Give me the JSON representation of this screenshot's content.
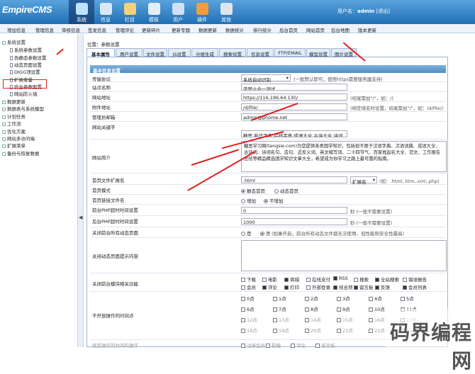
{
  "logo": {
    "text": "EmpireCMS"
  },
  "main_nav": [
    {
      "label": "系统",
      "icon": "monitor-icon",
      "color": "#bfe3ff"
    },
    {
      "label": "信息",
      "icon": "chat-icon",
      "color": "#d7e9f8"
    },
    {
      "label": "栏目",
      "icon": "folder-icon",
      "color": "#f3d27b"
    },
    {
      "label": "模板",
      "icon": "template-icon",
      "color": "#e2eef8"
    },
    {
      "label": "用户",
      "icon": "users-icon",
      "color": "#cfe2f5"
    },
    {
      "label": "插件",
      "icon": "plugin-icon",
      "color": "#f29d3a"
    },
    {
      "label": "其他",
      "icon": "gear-icon",
      "color": "#dde6ee"
    }
  ],
  "user": {
    "prefix": "用户名：",
    "name": "admin",
    "logout": "[退出]"
  },
  "sub_nav": [
    "增加信息",
    "管理信息",
    "审核信息",
    "签发信息",
    "管理评论",
    "更新碎片",
    "更新专题",
    "数据更新",
    "数据统计",
    "排行统计",
    "后台首页",
    "网站首页",
    "后台地图",
    "版本更新"
  ],
  "sidebar": [
    {
      "label": "系统设置",
      "type": "folder"
    },
    {
      "label": "系统参数设置",
      "type": "doc"
    },
    {
      "label": "伪静态参数设置",
      "type": "doc"
    },
    {
      "label": "动态页面设置",
      "type": "doc"
    },
    {
      "label": "DIGG顶设置",
      "type": "doc"
    },
    {
      "label": "扩展变量",
      "type": "doc"
    },
    {
      "label": "安全参数配置",
      "type": "doc"
    },
    {
      "label": "网站防火墙",
      "type": "doc"
    },
    {
      "label": "数据更新",
      "type": "folder"
    },
    {
      "label": "数据表与系统模型",
      "type": "folder"
    },
    {
      "label": "计划任务",
      "type": "folder"
    },
    {
      "label": "工作流",
      "type": "folder"
    },
    {
      "label": "优化方案",
      "type": "folder"
    },
    {
      "label": "网站多访问端",
      "type": "folder"
    },
    {
      "label": "扩展菜单",
      "type": "folder"
    },
    {
      "label": "备份与恢复数据",
      "type": "folder"
    }
  ],
  "splitter": {
    "label": "◀"
  },
  "breadcrumb": "位置：参数设置",
  "tabs": [
    "基本属性",
    "用户设置",
    "文件设置",
    "JS设置",
    "分组生成",
    "搜索设置",
    "信息设置",
    "FTP/EMAIL",
    "模型设置",
    "图片设置"
  ],
  "section_title": "基本信息设置",
  "form": {
    "protocol": {
      "label": "传输协议",
      "value": "系统自动识别",
      "hint": "(一般默认即可，使用https需要服务器支持)"
    },
    "site_name": {
      "label": "站点名称",
      "value": "帝国十合一测试"
    },
    "site_url": {
      "label": "网站地址",
      "value": "https://116.196.64.130/",
      "hint": "(结尾需加\"/\"，如：/)"
    },
    "attach_url": {
      "label": "附件地址",
      "value": "/d/file/",
      "hint": "(绑定域名时设置，结尾需加\"/\"，如：/d/file/)"
    },
    "admin_email": {
      "label": "管理员邮箱",
      "value": "admin@phome.net"
    },
    "keywords": {
      "label": "网站关键字",
      "value": "糖思,新华字典,在线字典,成语大全,古诗大全,诗词"
    },
    "description": {
      "label": "网站简介",
      "value": "糖思学习网(tangsie.com)为您提供各类国学知识，包括但不限于汉语字典、汉语词典、成语大全、古诗词、诗词名句、造句、近反义词、英文缩写词、二十四节气、百家姓起名大全、范文、工作报告总结等精品精选国学知识文章大全，希望成为你学习之路上最可靠的指南。"
    },
    "index_ext": {
      "label": "首页文件扩展名",
      "value": ".html",
      "select": "扩展名",
      "hint": "(如：.html,.htm,.xml,.php)"
    },
    "index_mode": {
      "label": "首页模式",
      "options": [
        "静态首页",
        "动态首页"
      ],
      "selected": 0
    },
    "link_filename": {
      "label": "首页链接文件名",
      "options": [
        "增加",
        "不增加"
      ],
      "selected": 1
    },
    "front_php_time": {
      "label": "前台PHP超时时间设置",
      "value": "0",
      "hint": "秒 (一般不需要设置)"
    },
    "back_php_time": {
      "label": "后台PHP超时时间设置",
      "value": "1000",
      "hint": "秒 (一般不需要设置)"
    },
    "close_front": {
      "label": "关闭前台所有动态页面",
      "options": [
        "是",
        "否"
      ],
      "selected": 1,
      "hint": "(如果开启，前台所有动态文件都无法使用，但性能和安全性最高)"
    },
    "close_tip": {
      "label": "关闭动态页面提示内容",
      "value": ""
    },
    "close_modules": {
      "label": "关闭前台模块相关功能",
      "row1": [
        {
          "t": "下载",
          "c": false
        },
        {
          "t": "电影",
          "c": false
        },
        {
          "t": "商城",
          "c": true
        },
        {
          "t": "在线支付",
          "c": false
        },
        {
          "t": "RSS",
          "c": true
        },
        {
          "t": "搜索",
          "c": false
        },
        {
          "t": "全站搜索",
          "c": true
        },
        {
          "t": "错误报告",
          "c": false
        }
      ],
      "row2": [
        {
          "t": "会员",
          "c": false
        },
        {
          "t": "评论",
          "c": true
        },
        {
          "t": "打印",
          "c": true
        },
        {
          "t": "外部登录",
          "c": false
        },
        {
          "t": "结合项",
          "c": true
        },
        {
          "t": "留言板",
          "c": true
        },
        {
          "t": "反馈",
          "c": true
        },
        {
          "t": "会员列表",
          "c": true
        }
      ]
    },
    "no_op_hours": {
      "label": "不开放操作的时间点",
      "hours": [
        "0点",
        "1点",
        "2点",
        "3点",
        "4点",
        "5点",
        "6点",
        "7点",
        "8点",
        "9点",
        "10点",
        "11点",
        "12点",
        "13点",
        "14点",
        "15点",
        "16点",
        "17点",
        "18点",
        "19点",
        "20点",
        "21点",
        "22点",
        "23点"
      ]
    },
    "limit_ops": {
      "label": "限定操作的时间的操作",
      "options": [
        "注册会员",
        "投稿",
        "评论",
        "留言板"
      ]
    }
  },
  "watermark": "码界编程网"
}
